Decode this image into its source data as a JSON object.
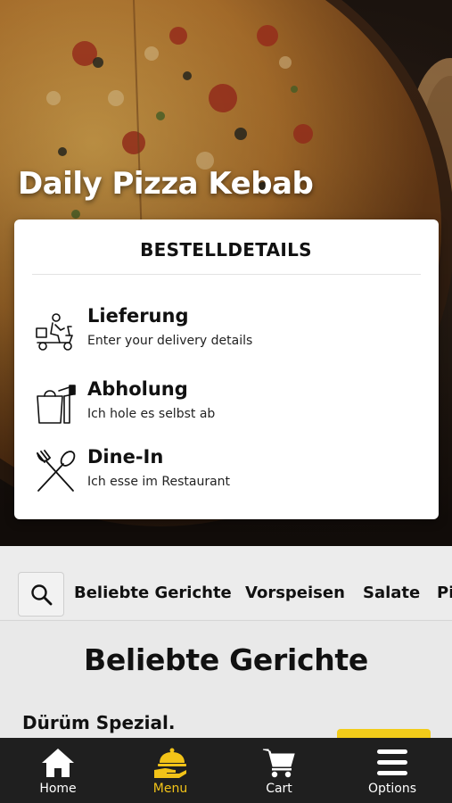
{
  "restaurant": {
    "name": "Daily Pizza Kebab"
  },
  "order_card": {
    "title": "BESTELLDETAILS",
    "options": [
      {
        "icon": "delivery-scooter-icon",
        "title": "Lieferung",
        "subtitle": "Enter your delivery details"
      },
      {
        "icon": "pickup-bag-icon",
        "title": "Abholung",
        "subtitle": "Ich hole es selbst ab"
      },
      {
        "icon": "fork-spoon-icon",
        "title": "Dine-In",
        "subtitle": "Ich esse im Restaurant"
      }
    ]
  },
  "categories": {
    "search_icon": "search-icon",
    "items": [
      "Beliebte Gerichte",
      "Vorspeisen",
      "Salate",
      "Pi"
    ]
  },
  "menu": {
    "section_title": "Beliebte Gerichte",
    "first_item": "Dürüm Spezial."
  },
  "bottom_nav": {
    "items": [
      {
        "label": "Home",
        "icon": "home-icon",
        "active": false
      },
      {
        "label": "Menu",
        "icon": "menu-cloche-icon",
        "active": true
      },
      {
        "label": "Cart",
        "icon": "cart-icon",
        "active": false
      },
      {
        "label": "Options",
        "icon": "hamburger-icon",
        "active": false
      }
    ]
  },
  "colors": {
    "accent": "#f2c318",
    "nav_bg": "#1f1f1f",
    "button": "#f2cc1a"
  }
}
